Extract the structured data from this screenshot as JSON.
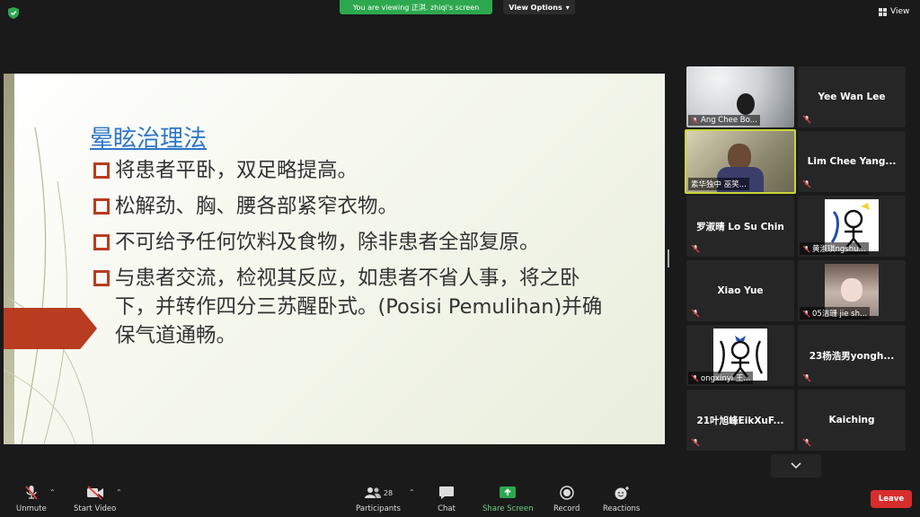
{
  "top_bar": {
    "banner_text": "You are viewing 正淇. zhiqi's screen",
    "view_options": "View Options",
    "view": "View"
  },
  "slide": {
    "title": "晕眩治理法",
    "bullets": [
      "将患者平卧，双足略提高。",
      "松解劲、胸、腰各部紧窄衣物。",
      "不可给予任何饮料及食物，除非患者全部复原。",
      "与患者交流，检视其反应，如患者不省人事，将之卧下，并转作四分三苏醒卧式。(Posisi Pemulihan)并确保气道通畅。"
    ]
  },
  "participants": [
    {
      "name": "Ang Chee Bo..."
    },
    {
      "name": "Yee Wan Lee"
    },
    {
      "name": "素华独中 巫笑..."
    },
    {
      "name": "Lim Chee Yang..."
    },
    {
      "name": "罗淑晴 Lo Su Chin"
    },
    {
      "name": "黄淑琪ngshu..."
    },
    {
      "name": "Xiao Yue"
    },
    {
      "name": "05洁珊 jie sh..."
    },
    {
      "name": "ongxinyi 王..."
    },
    {
      "name": "23杨浩男yongh..."
    },
    {
      "name": "21叶旭峰EikXuF..."
    },
    {
      "name": "Kaiching"
    }
  ],
  "toolbar": {
    "unmute": "Unmute",
    "start_video": "Start Video",
    "participants": "Participants",
    "participant_count": "28",
    "chat": "Chat",
    "share_screen": "Share Screen",
    "record": "Record",
    "reactions": "Reactions",
    "leave": "Leave"
  },
  "colors": {
    "banner": "#2da84f",
    "accent_red": "#b83c1f",
    "title_blue": "#2f77c9",
    "leave": "#d72d2d",
    "share_green": "#2da84f"
  }
}
